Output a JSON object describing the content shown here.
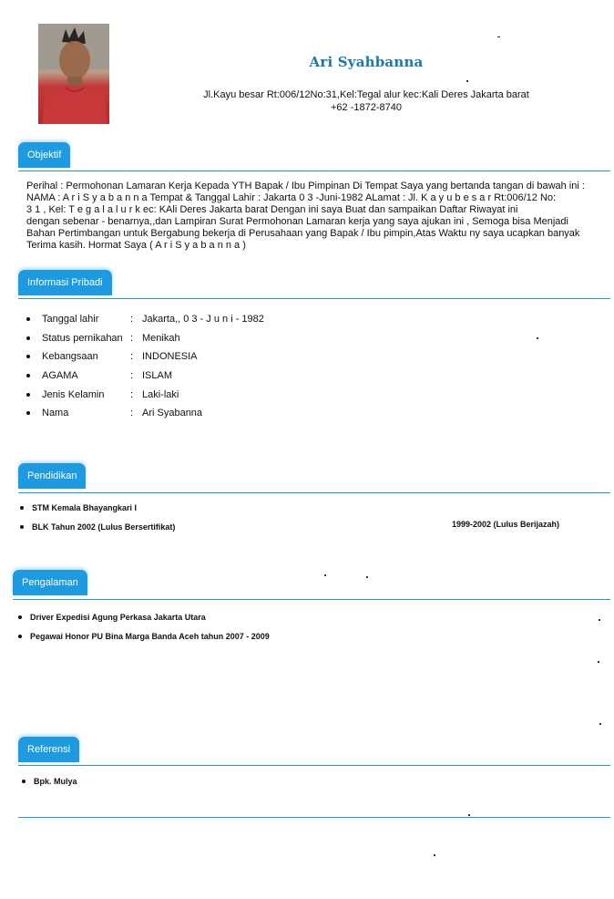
{
  "header": {
    "name": "Ari Syahbanna",
    "address": "Jl.Kayu besar Rt:006/12No:31,Kel:Tegal alur kec:Kali Deres  Jakarta barat",
    "phone": "+62 -1872-8740"
  },
  "objektif": {
    "title": "Objektif",
    "lines": [
      "Perihal : Permohonan Lamaran Kerja Kepada YTH Bapak / Ibu Pimpinan Di Tempat Saya yang bertanda tangan di bawah ini :",
      "NAMA : A r i   S y a b a n n a   Tempat & Tanggal Lahir : Jakarta 0 3 -Juni-1982 ALamat : Jl. K a y u   b e s a r   Rt:006/12 No:",
      "3 1 , Kel: T e g a l   a l u r   k ec: KAli Deres  Jakarta barat Dengan ini saya Buat dan sampaikan Daftar Riwayat ini",
      "dengan sebenar - benarnya,,dan Lampiran Surat Permohonan Lamaran kerja yang saya ajukan ini , Semoga bisa Menjadi",
      "Bahan Pertimbangan untuk Bergabung bekerja di Perusahaan yang Bapak / Ibu pimpin,Atas Waktu ny saya ucapkan banyak",
      "Terima kasih. Hormat Saya ( A r i   S y a b a n n a )"
    ]
  },
  "informasi": {
    "title": "Informasi Pribadi",
    "items": [
      {
        "label": "Tanggal lahir",
        "value": "Jakarta,, 0 3 - J u n i - 1982"
      },
      {
        "label": "Status pernikahan",
        "value": "Menikah"
      },
      {
        "label": "Kebangsaan",
        "value": "INDONESIA"
      },
      {
        "label": "AGAMA",
        "value": "ISLAM"
      },
      {
        "label": "Jenis Kelamin",
        "value": "Laki-laki"
      },
      {
        "label": "Nama",
        "value": " Ari Syabanna"
      }
    ],
    "separator": ":"
  },
  "pendidikan": {
    "title": "Pendidikan",
    "items": [
      "STM Kemala Bhayangkari I",
      "BLK Tahun 2002 (Lulus Bersertifikat)"
    ],
    "note": "1999-2002 (Lulus Berijazah)"
  },
  "pengalaman": {
    "title": "Pengalaman",
    "items": [
      "Driver Expedisi Agung Perkasa Jakarta Utara",
      "Pegawai  Honor  PU Bina Marga Banda Aceh tahun 2007 - 2009"
    ]
  },
  "referensi": {
    "title": "Referensi",
    "items": [
      "Bpk. Mulya"
    ]
  },
  "colors": {
    "accent": "#1e9ae0",
    "name": "#1a7ab0"
  }
}
